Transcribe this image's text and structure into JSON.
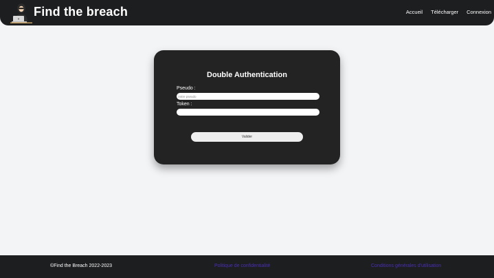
{
  "header": {
    "brand": "Find the breach",
    "logo_icon": "hacker-at-laptop-icon",
    "nav": [
      "Accueil",
      "Télécharger",
      "Connexion"
    ]
  },
  "login_card": {
    "title": "Double Authentication",
    "pseudo_label": "Pseudo :",
    "pseudo_placeholder": "Votre pseudo",
    "pseudo_value": "",
    "token_label": "Token :",
    "token_placeholder": "",
    "token_value": "",
    "submit_label": "Valider"
  },
  "footer": {
    "copyright": "©Find the Breach 2022-2023",
    "privacy_link": "Politique de confidentialité",
    "terms_link": "Conditions générales d'utilisation"
  },
  "colors": {
    "header_bg": "#1d1e20",
    "page_bg": "#f3f4f6",
    "card_bg": "#232323",
    "footer_link": "#4a2fb3"
  }
}
